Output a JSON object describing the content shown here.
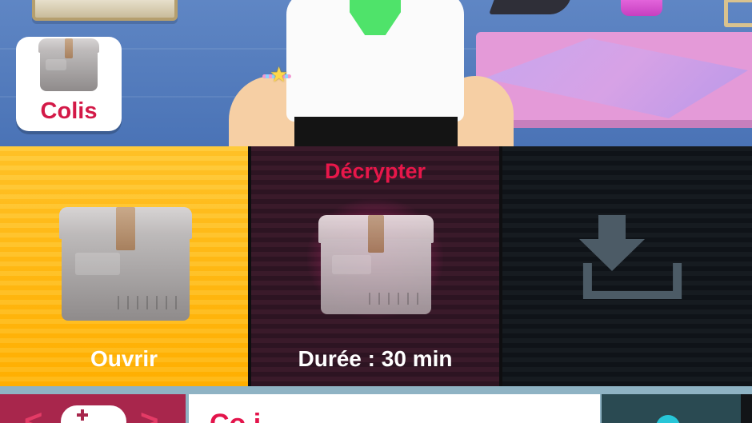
{
  "scene": {
    "colis_label": "Colis"
  },
  "panels": {
    "open": {
      "label": "Ouvrir"
    },
    "decrypt": {
      "title": "Décrypter",
      "duration": "Durée : 30 min"
    },
    "slot": {
      "icon": "download-icon"
    }
  },
  "bottom_bar": {
    "middle_text": "Co  i",
    "left_icon": "gamepad-icon",
    "left_arrows": [
      "<",
      ">"
    ]
  },
  "colors": {
    "accent_red": "#d31947",
    "open_panel": "#ffb600",
    "decrypt_panel": "#2d1422",
    "slot_panel": "#0f1318"
  }
}
